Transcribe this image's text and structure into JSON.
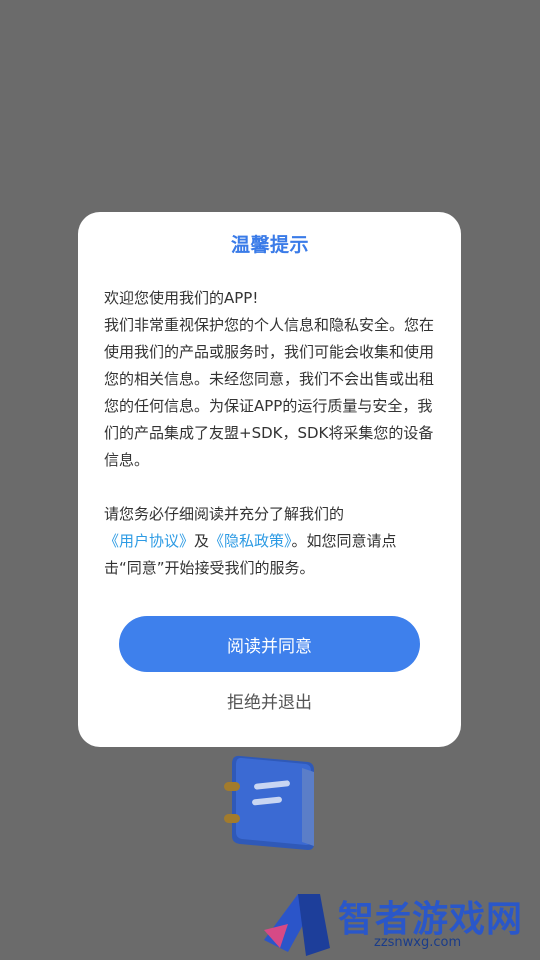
{
  "dialog": {
    "title": "温馨提示",
    "intro": "欢迎您使用我们的APP!",
    "body": "我们非常重视保护您的个人信息和隐私安全。您在使用我们的产品或服务时，我们可能会收集和使用您的相关信息。未经您同意，我们不会出售或出租您的任何信息。为保证APP的运行质量与安全，我们的产品集成了友盟+SDK，SDK将采集您的设备信息。",
    "notice_prefix": "请您务必仔细阅读并充分了解我们的",
    "user_agreement_link": "《用户协议》",
    "notice_and": "及",
    "privacy_policy_link": "《隐私政策》",
    "notice_suffix": "。如您同意请点击“同意”开始接受我们的服务。",
    "agree_button": "阅读并同意",
    "reject_button": "拒绝并退出"
  },
  "watermark": {
    "name": "智者游戏网",
    "url": "zzsnwxg.com"
  },
  "colors": {
    "accent": "#3e80ec",
    "title": "#3a7be8",
    "link": "#2d9be4",
    "overlay": "#6b6b6b"
  },
  "icons": {
    "background_logo": "notebook-icon",
    "watermark_logo": "triangle-logo-icon"
  }
}
